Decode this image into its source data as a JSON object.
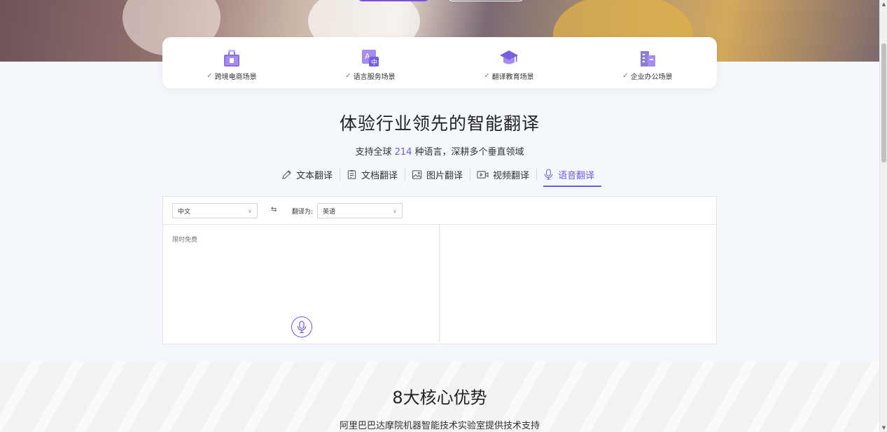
{
  "scenes": [
    {
      "label": "跨境电商场景",
      "icon": "shopping-bag-icon"
    },
    {
      "label": "语言服务场景",
      "icon": "language-translate-icon"
    },
    {
      "label": "翻译教育场景",
      "icon": "graduation-cap-icon"
    },
    {
      "label": "企业办公场景",
      "icon": "office-building-icon"
    }
  ],
  "check_glyph": "✓",
  "translate_section": {
    "title": "体验行业领先的智能翻译",
    "subtitle_pre": "支持全球 ",
    "language_count": "214",
    "subtitle_post": " 种语言，深耕多个垂直领域"
  },
  "tabs": [
    {
      "label": "文本翻译",
      "icon": "pencil-icon"
    },
    {
      "label": "文档翻译",
      "icon": "document-icon"
    },
    {
      "label": "图片翻译",
      "icon": "image-icon"
    },
    {
      "label": "视频翻译",
      "icon": "video-icon"
    },
    {
      "label": "语音翻译",
      "icon": "microphone-icon",
      "active": true
    }
  ],
  "panel": {
    "source_language": "中文",
    "swap_glyph": "⇆",
    "target_label": "翻译为:",
    "target_language": "英语",
    "placeholder": "限时免费",
    "chevron_glyph": "∨"
  },
  "advantages": {
    "title": "8大核心优势",
    "subtitle": "阿里巴巴达摩院机器智能技术实验室提供技术支持"
  },
  "colors": {
    "accent": "#6c5ce7",
    "scene_icon": "#8b6fe3"
  }
}
